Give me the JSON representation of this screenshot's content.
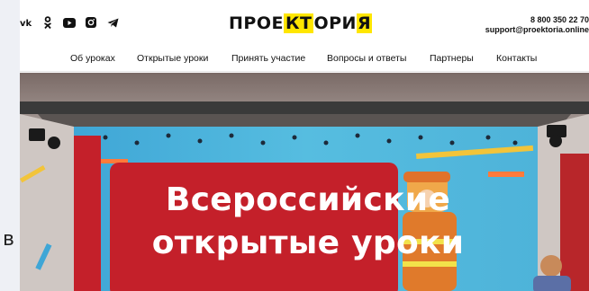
{
  "header": {
    "socials": [
      {
        "icon": "vk-icon",
        "glyph": "ꓘ"
      },
      {
        "icon": "odnoklassniki-icon"
      },
      {
        "icon": "youtube-icon"
      },
      {
        "icon": "instagram-icon"
      },
      {
        "icon": "telegram-icon"
      }
    ],
    "logo": {
      "part1": "ПРОЕ",
      "part2": "КТ",
      "part3": "ОРИ",
      "part4": "Я"
    },
    "phone": "8 800 350 22 70",
    "email": "support@proektoria.online"
  },
  "nav": {
    "items": [
      {
        "label": "Об уроках"
      },
      {
        "label": "Открытые уроки"
      },
      {
        "label": "Принять участие"
      },
      {
        "label": "Вопросы и ответы"
      },
      {
        "label": "Партнеры"
      },
      {
        "label": "Контакты"
      }
    ]
  },
  "hero": {
    "title_line1": "Всероссийские",
    "title_line2": "открытые уроки"
  },
  "outside_text": "в",
  "colors": {
    "accent": "#ffe600",
    "hero_red": "#c4202a"
  }
}
